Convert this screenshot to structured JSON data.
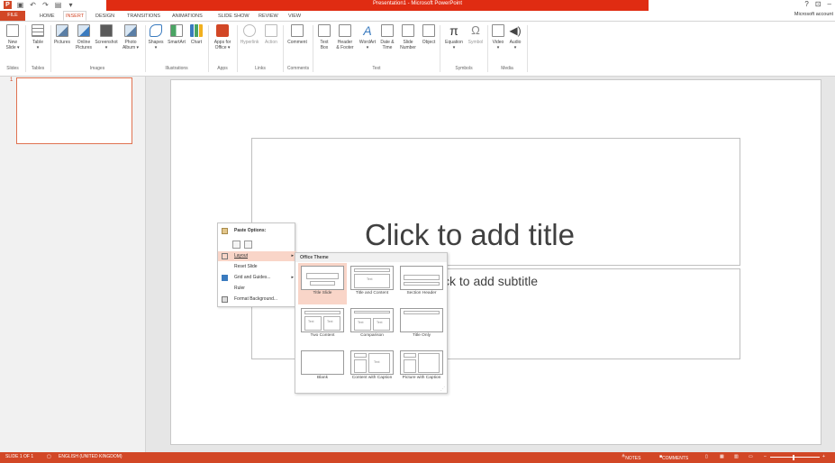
{
  "titlebar": {
    "title": "Presentation1 - Microsoft PowerPoint",
    "help": "?",
    "restore": "⊡",
    "minimize": "–"
  },
  "tabs": {
    "file": "FILE",
    "items": [
      "HOME",
      "INSERT",
      "DESIGN",
      "TRANSITIONS",
      "ANIMATIONS",
      "SLIDE SHOW",
      "REVIEW",
      "VIEW"
    ],
    "active": "INSERT",
    "account": "Microsoft account"
  },
  "ribbon": {
    "buttons": [
      {
        "label": "New\nSlide ▾",
        "icon": "new-slide-icon"
      },
      {
        "label": "Table\n▾",
        "icon": "table-icon"
      },
      {
        "label": "Pictures",
        "icon": "pictures-icon"
      },
      {
        "label": "Online\nPictures",
        "icon": "online-pictures-icon"
      },
      {
        "label": "Screenshot\n▾",
        "icon": "screenshot-icon"
      },
      {
        "label": "Photo\nAlbum ▾",
        "icon": "photo-album-icon"
      },
      {
        "label": "Shapes\n▾",
        "icon": "shapes-icon"
      },
      {
        "label": "SmartArt",
        "icon": "smartart-icon"
      },
      {
        "label": "Chart",
        "icon": "chart-icon"
      },
      {
        "label": "Apps for\nOffice ▾",
        "icon": "apps-icon"
      },
      {
        "label": "Hyperlink",
        "icon": "hyperlink-icon"
      },
      {
        "label": "Action",
        "icon": "action-icon"
      },
      {
        "label": "Comment",
        "icon": "comment-icon"
      },
      {
        "label": "Text\nBox",
        "icon": "text-box-icon"
      },
      {
        "label": "Header\n& Footer",
        "icon": "header-footer-icon"
      },
      {
        "label": "WordArt\n▾",
        "icon": "wordart-icon"
      },
      {
        "label": "Date &\nTime",
        "icon": "date-time-icon"
      },
      {
        "label": "Slide\nNumber",
        "icon": "slide-number-icon"
      },
      {
        "label": "Object",
        "icon": "object-icon"
      },
      {
        "label": "Equation\n▾",
        "icon": "equation-icon"
      },
      {
        "label": "Symbol",
        "icon": "symbol-icon"
      },
      {
        "label": "Video\n▾",
        "icon": "video-icon"
      },
      {
        "label": "Audio\n▾",
        "icon": "audio-icon"
      }
    ],
    "groups": [
      "Slides",
      "Tables",
      "Images",
      "Illustrations",
      "Apps",
      "Links",
      "Comments",
      "Text",
      "Symbols",
      "Media"
    ]
  },
  "thumbnails": {
    "number": "1"
  },
  "slide": {
    "title_placeholder": "Click to add title",
    "subtitle_placeholder": "ck to add subtitle"
  },
  "context_menu": {
    "paste_options": "Paste Options:",
    "layout": "Layout",
    "reset_slide": "Reset Slide",
    "grid_and_guides": "Grid and Guides...",
    "ruler": "Ruler",
    "format_background": "Format Background..."
  },
  "layout_gallery": {
    "header": "Office Theme",
    "placeholder_text": "Text",
    "items": [
      {
        "label": "Title Slide",
        "selected": true
      },
      {
        "label": "Title and Content",
        "selected": false
      },
      {
        "label": "Section Header",
        "selected": false
      },
      {
        "label": "Two Content",
        "selected": false
      },
      {
        "label": "Comparison",
        "selected": false
      },
      {
        "label": "Title Only",
        "selected": false
      },
      {
        "label": "Blank",
        "selected": false
      },
      {
        "label": "Content with Caption",
        "selected": false
      },
      {
        "label": "Picture with Caption",
        "selected": false
      }
    ]
  },
  "statusbar": {
    "slide": "SLIDE 1 OF 1",
    "language": "ENGLISH (UNITED KINGDOM)",
    "notes": "NOTES",
    "comments": "COMMENTS",
    "zoom_minus": "–",
    "zoom_plus": "+"
  },
  "colors": {
    "accent": "#d24726",
    "selection": "#f9d5c8"
  }
}
